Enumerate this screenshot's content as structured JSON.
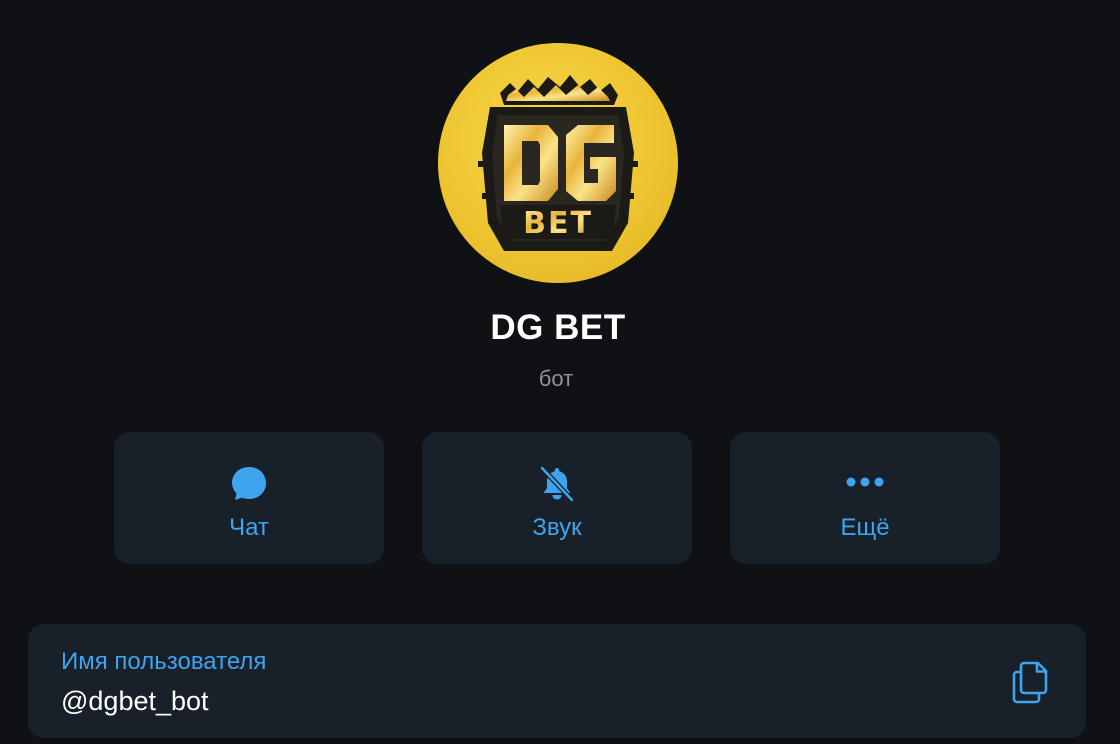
{
  "profile": {
    "avatar_logo_text": "DG BET",
    "name": "DG BET",
    "subtitle": "бот"
  },
  "actions": [
    {
      "label": "Чат",
      "icon": "chat-bubble-icon"
    },
    {
      "label": "Звук",
      "icon": "bell-muted-icon"
    },
    {
      "label": "Ещё",
      "icon": "more-dots-icon"
    }
  ],
  "username_card": {
    "label": "Имя пользователя",
    "value": "@dgbet_bot",
    "icon": "copy-icon"
  },
  "colors": {
    "background": "#0f1114",
    "card": "#182029",
    "accent": "#3ea4ee",
    "subtitle": "#8e9399",
    "avatar_gold": "#eec531"
  }
}
